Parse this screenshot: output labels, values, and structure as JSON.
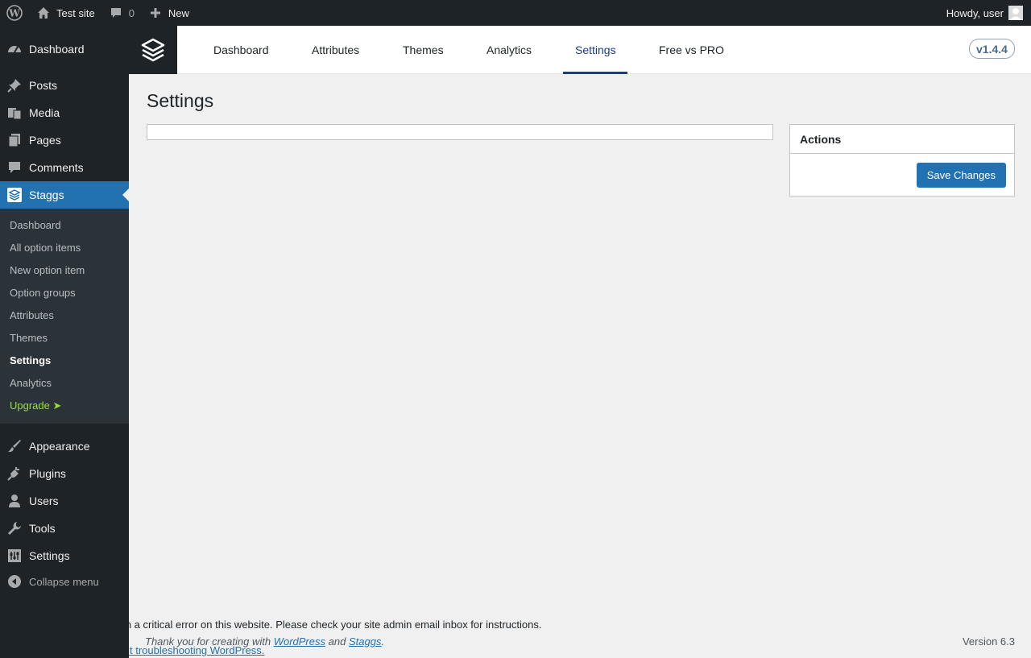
{
  "adminbar": {
    "site_name": "Test site",
    "comments_count": "0",
    "new_label": "New",
    "howdy": "Howdy, user"
  },
  "sidebar": {
    "items": [
      {
        "label": "Dashboard",
        "icon": "dashboard-icon"
      },
      {
        "label": "Posts",
        "icon": "pin-icon"
      },
      {
        "label": "Media",
        "icon": "media-icon"
      },
      {
        "label": "Pages",
        "icon": "pages-icon"
      },
      {
        "label": "Comments",
        "icon": "comment-icon"
      },
      {
        "label": "Staggs",
        "icon": "staggs-icon"
      },
      {
        "label": "Appearance",
        "icon": "brush-icon"
      },
      {
        "label": "Plugins",
        "icon": "plug-icon"
      },
      {
        "label": "Users",
        "icon": "user-icon"
      },
      {
        "label": "Tools",
        "icon": "wrench-icon"
      },
      {
        "label": "Settings",
        "icon": "sliders-icon"
      }
    ],
    "submenu": [
      "Dashboard",
      "All option items",
      "New option item",
      "Option groups",
      "Attributes",
      "Themes",
      "Settings",
      "Analytics",
      "Upgrade ➤"
    ],
    "collapse_label": "Collapse menu"
  },
  "plugin_header": {
    "tabs": [
      "Dashboard",
      "Attributes",
      "Themes",
      "Analytics",
      "Settings",
      "Free vs PRO"
    ],
    "active_tab": "Settings",
    "version": "v1.4.4"
  },
  "page": {
    "title": "Settings"
  },
  "actions": {
    "title": "Actions",
    "save_label": "Save Changes"
  },
  "footer": {
    "notice": "There has been a critical error on this website. Please check your site admin email inbox for instructions.",
    "notice_link": "Learn more about troubleshooting WordPress.",
    "thanks_prefix": "Thank you for creating with",
    "wordpress_link": "WordPress",
    "and": "and",
    "staggs_link": "Staggs",
    "period": ".",
    "version": "Version 6.3"
  },
  "colors": {
    "admin_bg": "#1d2327",
    "accent": "#2271b1",
    "active_tab": "#1e3a8a",
    "upgrade": "#9bde36"
  }
}
